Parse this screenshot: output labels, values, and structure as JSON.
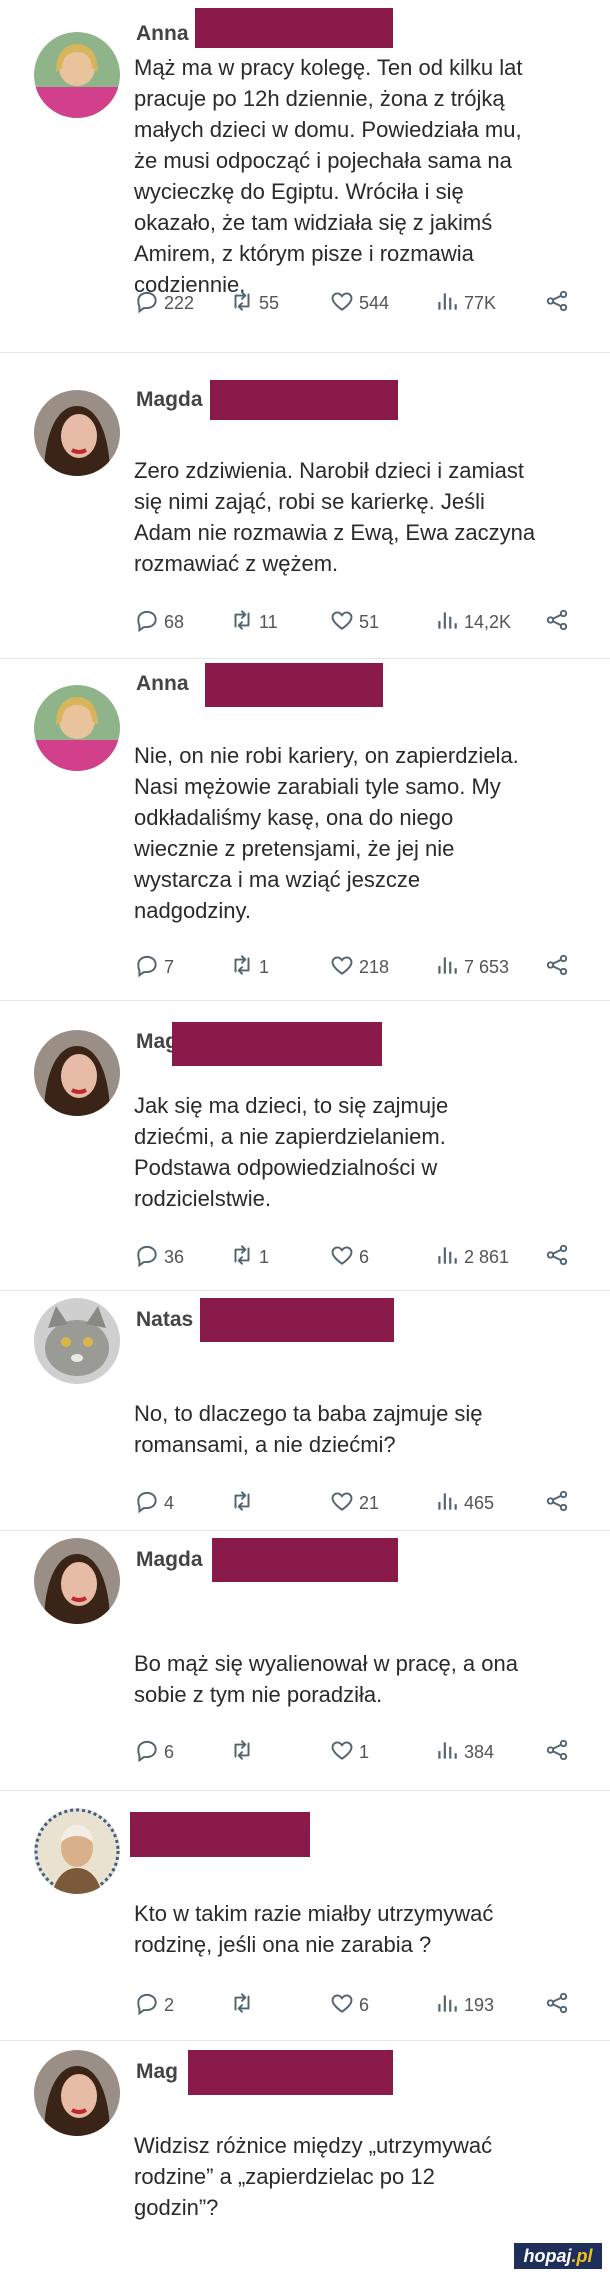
{
  "tweets": [
    {
      "name": "Anna",
      "lines": [
        "Mąż ma w pracy kolegę. Ten od kilku lat",
        "pracuje po 12h dziennie, żona z trójką",
        "małych dzieci w domu. Powiedziała mu,",
        "że musi odpocząć i pojechała sama na",
        "wycieczkę do Egiptu. Wróciła i się",
        "okazało, że tam widziała się z jakimś",
        "Amirem, z którym pisze i rozmawia",
        "codziennie."
      ],
      "replies": "222",
      "reposts": "55",
      "likes": "544",
      "views": "77K"
    },
    {
      "name": "Magda",
      "lines": [
        "Zero zdziwienia. Narobił dzieci i zamiast",
        "się nimi zająć, robi se karierkę. Jeśli",
        "Adam nie rozmawia z Ewą, Ewa zaczyna",
        "rozmawiać z wężem."
      ],
      "replies": "68",
      "reposts": "11",
      "likes": "51",
      "views": "14,2K"
    },
    {
      "name": "Anna",
      "lines": [
        "Nie, on nie robi kariery, on zapierdziela.",
        "Nasi mężowie zarabiali tyle samo. My",
        "odkładaliśmy kasę, ona do niego",
        "wiecznie z pretensjami, że jej nie",
        "wystarcza i ma wziąć jeszcze",
        "nadgodziny."
      ],
      "replies": "7",
      "reposts": "1",
      "likes": "218",
      "views": "7 653"
    },
    {
      "name": "Mag",
      "lines": [
        "Jak się ma dzieci, to się zajmuje",
        "dziećmi, a nie zapierdzielaniem.",
        "Podstawa odpowiedzialności w",
        "rodzicielstwie."
      ],
      "replies": "36",
      "reposts": "1",
      "likes": "6",
      "views": "2 861"
    },
    {
      "name": "Natas",
      "lines": [
        "No, to dlaczego ta baba zajmuje się",
        "romansami, a nie dziećmi?"
      ],
      "replies": "4",
      "reposts": "",
      "likes": "21",
      "views": "465"
    },
    {
      "name": "Magda",
      "lines": [
        "Bo mąż się wyalienował w pracę, a ona",
        "sobie z tym nie poradziła."
      ],
      "replies": "6",
      "reposts": "",
      "likes": "1",
      "views": "384"
    },
    {
      "name": "",
      "lines": [
        "Kto w takim razie miałby utrzymywać",
        "rodzinę, jeśli ona nie zarabia ?"
      ],
      "replies": "2",
      "reposts": "",
      "likes": "6",
      "views": "193"
    },
    {
      "name": "Mag",
      "lines": [
        "Widzisz różnice między „utrzymywać",
        "rodzine” a „zapierdzielac po 12",
        "godzin”?"
      ]
    }
  ],
  "watermark": {
    "main": "hopaj",
    "suffix": ".pl"
  },
  "colors": {
    "redaction": "#8a1a4a",
    "brand_bg": "#1d2f5a",
    "brand_accent": "#f0c020"
  }
}
